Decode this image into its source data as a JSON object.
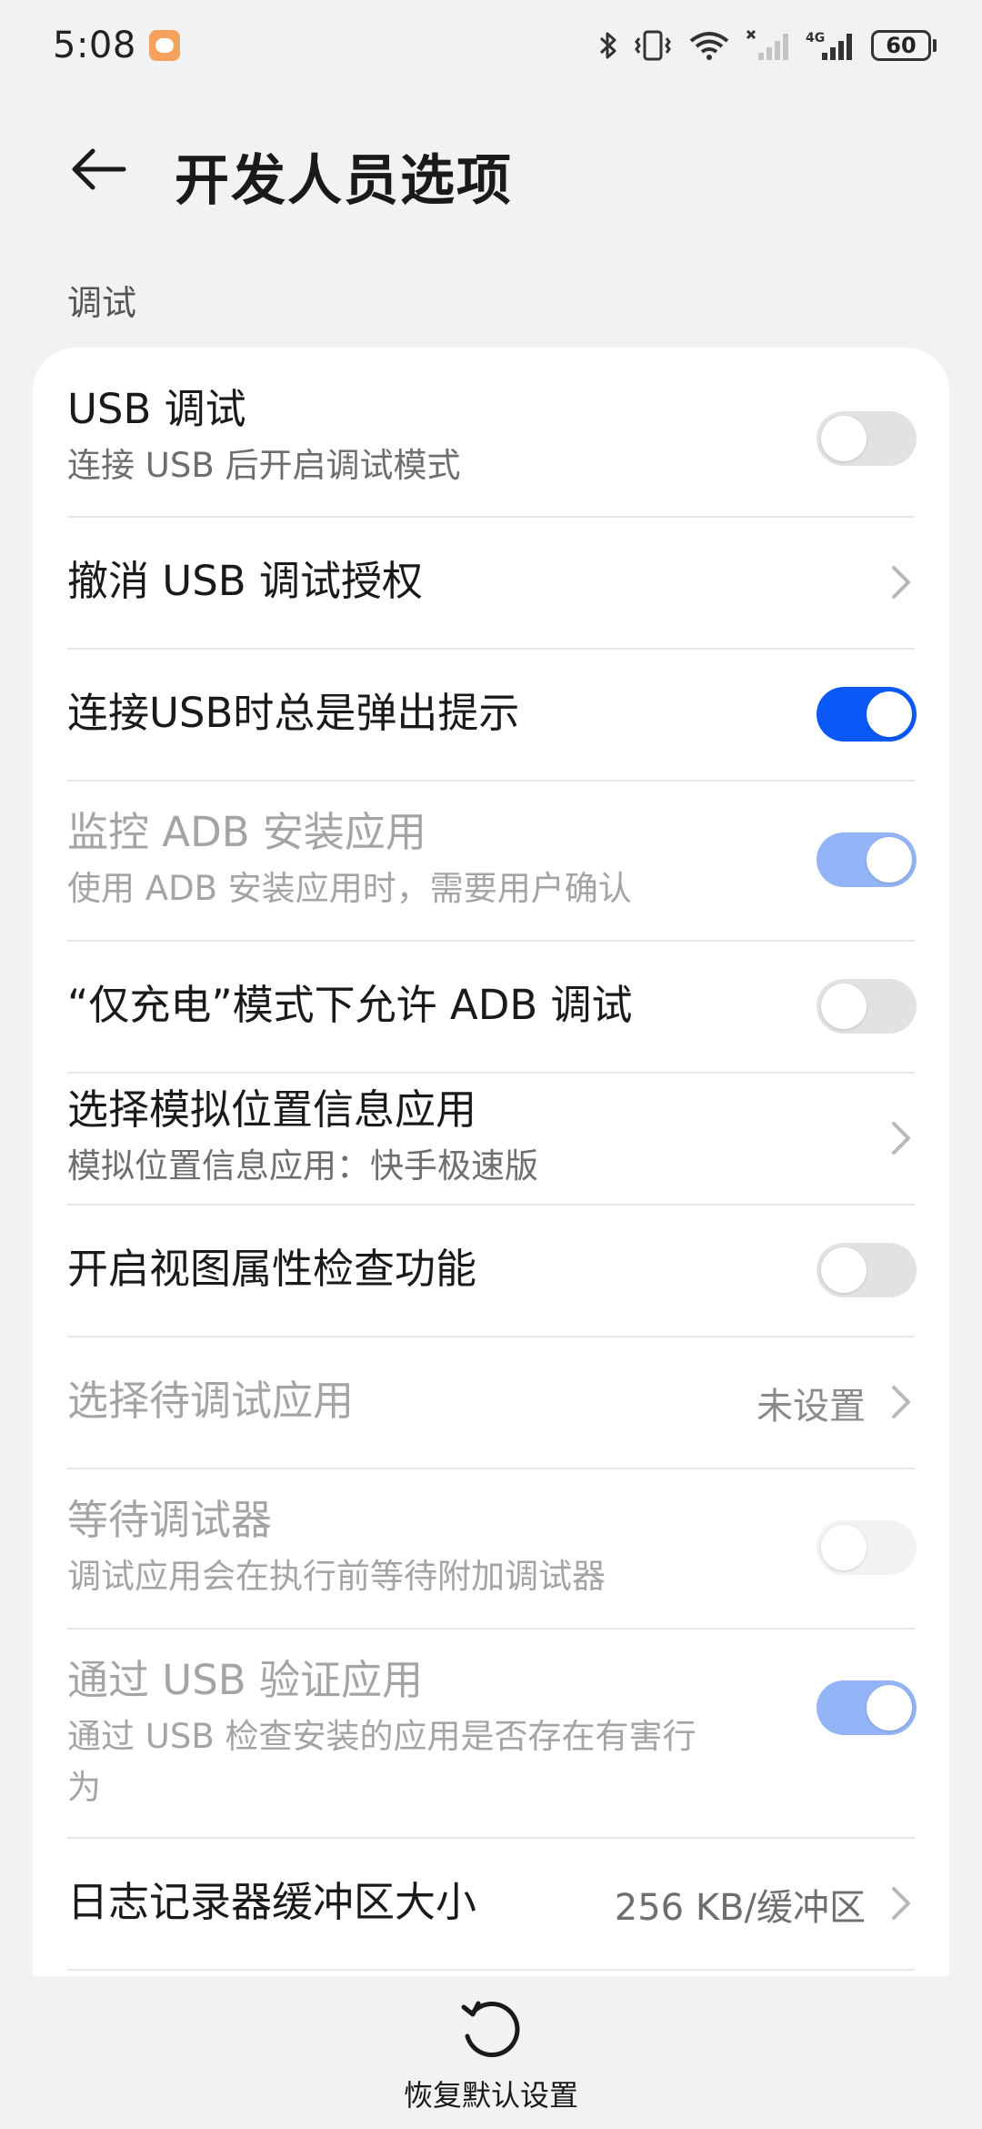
{
  "status_bar": {
    "time": "5:08",
    "battery": "60",
    "network_label": "4G",
    "icons": [
      "bluetooth-icon",
      "vibrate-icon",
      "wifi-icon",
      "signal-off-icon",
      "signal-4g-icon",
      "battery-icon"
    ]
  },
  "header": {
    "title": "开发人员选项",
    "back_icon": "back-arrow-icon"
  },
  "section": {
    "label": "调试"
  },
  "items": [
    {
      "title": "USB 调试",
      "subtitle": "连接 USB 后开启调试模式",
      "control": "toggle",
      "state": "off"
    },
    {
      "title": "撤消 USB 调试授权",
      "control": "chevron"
    },
    {
      "title": "连接USB时总是弹出提示",
      "control": "toggle",
      "state": "on"
    },
    {
      "title": "监控 ADB 安装应用",
      "subtitle": "使用 ADB 安装应用时，需要用户确认",
      "control": "toggle",
      "state": "on",
      "disabled": true
    },
    {
      "title": "“仅充电”模式下允许 ADB 调试",
      "control": "toggle",
      "state": "off"
    },
    {
      "title": "选择模拟位置信息应用",
      "subtitle": "模拟位置信息应用：快手极速版",
      "control": "chevron"
    },
    {
      "title": "开启视图属性检查功能",
      "control": "toggle",
      "state": "off"
    },
    {
      "title": "选择待调试应用",
      "value": "未设置",
      "control": "chevron",
      "disabled": true
    },
    {
      "title": "等待调试器",
      "subtitle": "调试应用会在执行前等待附加调试器",
      "control": "toggle",
      "state": "off",
      "disabled": true
    },
    {
      "title": "通过 USB 验证应用",
      "subtitle_line1": "通过 USB 检查安装的应用是否存在有害行",
      "subtitle_line2": "为",
      "control": "toggle",
      "state": "on",
      "disabled": true
    },
    {
      "title": "日志记录器缓冲区大小",
      "value": "256 KB/缓冲区",
      "control": "chevron"
    }
  ],
  "bottom": {
    "restore_label": "恢复默认设置",
    "icon": "restore-icon"
  },
  "colors": {
    "accent": "#0a59f7",
    "accent_disabled": "#93b4f7",
    "background": "#f1f2f4",
    "card": "#ffffff"
  }
}
